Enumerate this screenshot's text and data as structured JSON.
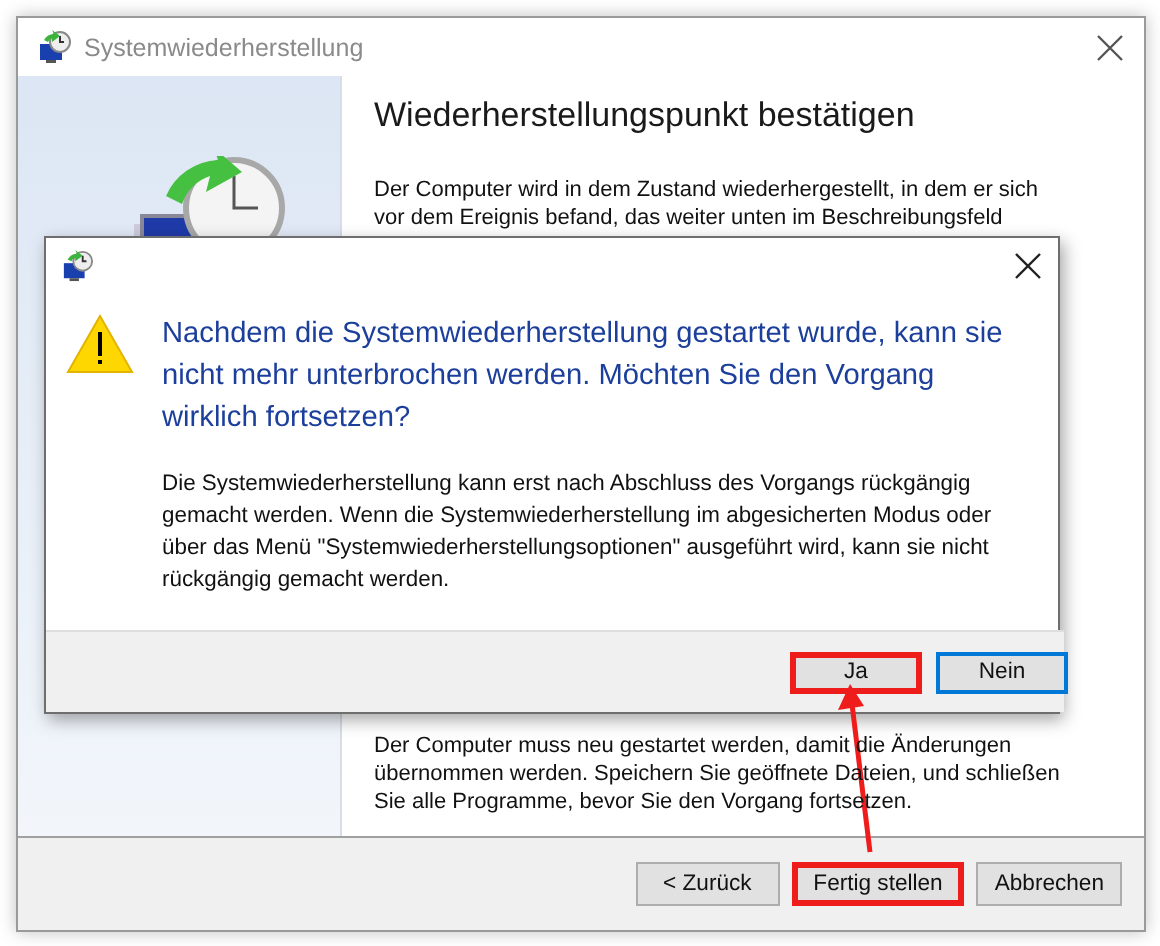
{
  "window": {
    "title": "Systemwiederherstellung",
    "heading": "Wiederherstellungspunkt bestätigen",
    "top_paragraph": "Der Computer wird in dem Zustand wiederhergestellt, in dem er sich vor dem Ereignis befand, das weiter unten im Beschreibungsfeld",
    "bottom_paragraph": "Der Computer muss neu gestartet werden, damit die Änderungen übernommen werden. Speichern Sie geöffnete Dateien, und schließen Sie alle Programme, bevor Sie den Vorgang fortsetzen.",
    "buttons": [
      {
        "label": "< Zurück",
        "highlighted": false
      },
      {
        "label": "Fertig stellen",
        "highlighted": true
      },
      {
        "label": "Abbrechen",
        "highlighted": false
      }
    ]
  },
  "dialog": {
    "question": "Nachdem die Systemwiederherstellung gestartet wurde, kann sie nicht mehr unterbrochen werden. Möchten Sie den Vorgang wirklich fortsetzen?",
    "message": "Die Systemwiederherstellung kann erst nach Abschluss des Vorgangs rückgängig gemacht werden. Wenn die Systemwiederherstellung im abgesicherten Modus oder über das Menü \"Systemwiederherstellungsoptionen\" ausgeführt wird, kann sie nicht rückgängig gemacht werden.",
    "buttons": [
      {
        "label": "Ja",
        "highlighted": true,
        "default": false
      },
      {
        "label": "Nein",
        "highlighted": false,
        "default": true
      }
    ]
  }
}
